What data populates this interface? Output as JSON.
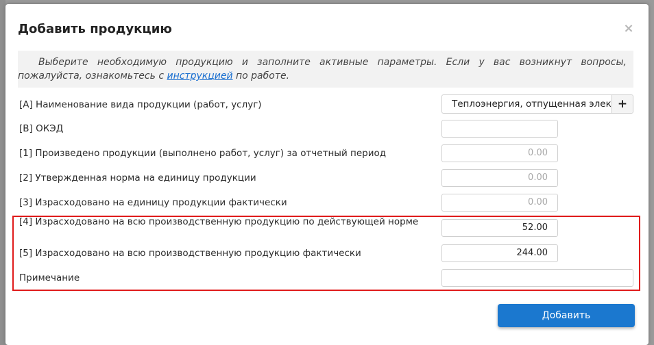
{
  "modal": {
    "title": "Добавить продукцию",
    "close_symbol": "×",
    "info_text_before": "Выберите необходимую продукцию и заполните активные параметры. Если у вас возникнут вопросы, пожалуйста, ознакомьтесь с ",
    "info_link": "инструкцией",
    "info_text_after": " по работе."
  },
  "form": {
    "rows": [
      {
        "label": "[A] Наименование вида продукции (работ, услуг)",
        "value": "Теплоэнергия, отпущенная электростанциями"
      },
      {
        "label": "[B] ОКЭД",
        "value": ""
      },
      {
        "label": "[1] Произведено продукции (выполнено работ, услуг) за отчетный период",
        "value": "0.00"
      },
      {
        "label": "[2] Утвержденная норма на единицу продукции",
        "value": "0.00"
      },
      {
        "label": "[3] Израсходовано на единицу продукции фактически",
        "value": "0.00"
      },
      {
        "label": "[4] Израсходовано на всю производственную продукцию по действующей норме",
        "value": "52.00"
      },
      {
        "label": "[5] Израсходовано на всю производственную продукцию фактически",
        "value": "244.00"
      },
      {
        "label": "Примечание",
        "value": ""
      }
    ],
    "add_symbol": "+"
  },
  "actions": {
    "submit_label": "Добавить"
  },
  "colors": {
    "primary": "#1b78cf",
    "highlight": "#e01b1b",
    "link": "#1a6fd0"
  }
}
